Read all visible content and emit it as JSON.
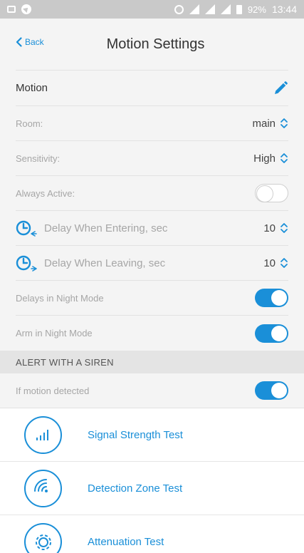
{
  "status_bar": {
    "battery": "92%",
    "time": "13:44"
  },
  "header": {
    "back_label": "Back",
    "title": "Motion Settings"
  },
  "device": {
    "name": "Motion"
  },
  "settings": {
    "room": {
      "label": "Room:",
      "value": "main"
    },
    "sensitivity": {
      "label": "Sensitivity:",
      "value": "High"
    },
    "always_active": {
      "label": "Always Active:",
      "on": false
    },
    "delay_entering": {
      "label": "Delay When Entering, sec",
      "value": "10"
    },
    "delay_leaving": {
      "label": "Delay When Leaving, sec",
      "value": "10"
    },
    "delays_night": {
      "label": "Delays in Night Mode",
      "on": true
    },
    "arm_night": {
      "label": "Arm in Night Mode",
      "on": true
    }
  },
  "siren": {
    "header": "ALERT WITH A SIREN",
    "motion_detected": {
      "label": "If motion detected",
      "on": true
    }
  },
  "tests": [
    {
      "label": "Signal Strength Test",
      "icon": "signal-bars-icon"
    },
    {
      "label": "Detection Zone Test",
      "icon": "detection-zone-icon"
    },
    {
      "label": "Attenuation Test",
      "icon": "gear-icon"
    }
  ],
  "colors": {
    "accent": "#1a8fd8",
    "status_bar": "#c9c9c9",
    "background": "#f4f4f4"
  }
}
